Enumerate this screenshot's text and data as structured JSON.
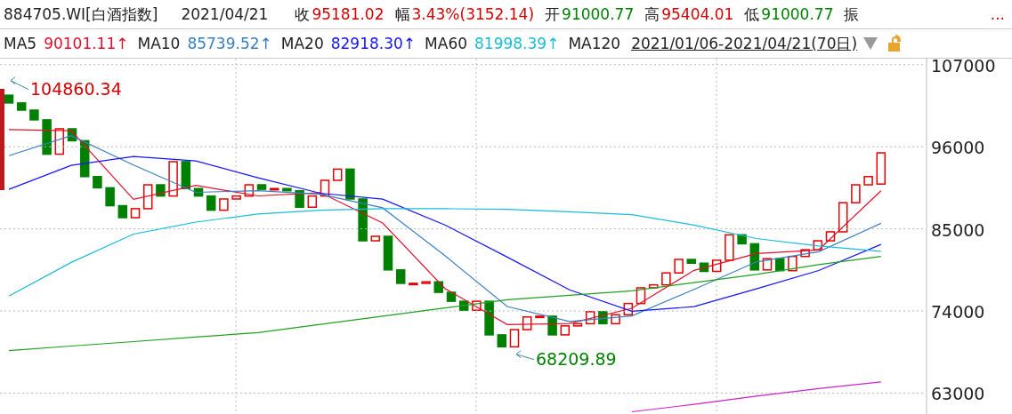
{
  "quote": {
    "code": "884705.WI[白酒指数]",
    "date": "2021/04/21",
    "fields": [
      {
        "label": "收",
        "value": "95181.02",
        "color": "#d40000"
      },
      {
        "label": "幅",
        "value": "3.43%(3152.14)",
        "color": "#d40000"
      },
      {
        "label": "开",
        "value": "91000.77",
        "color": "#008000"
      },
      {
        "label": "高",
        "value": "95404.01",
        "color": "#d40000"
      },
      {
        "label": "低",
        "value": "91000.77",
        "color": "#008000"
      },
      {
        "label": "振"
      }
    ],
    "more": "..."
  },
  "ma_readings": [
    "90101.11↑",
    "85739.52↑",
    "82918.30↑",
    "81998.39↑"
  ],
  "range": "2021/01/06-2021/04/21(70日)",
  "chart_data": {
    "type": "line",
    "grid": true,
    "ylim": [
      60200,
      107800
    ],
    "yticks": [
      63000,
      74000,
      85000,
      96000,
      107000
    ],
    "categories": [
      null,
      null,
      null,
      null,
      null,
      null,
      null,
      null,
      null,
      null,
      null,
      null,
      null,
      null,
      null
    ],
    "series": [
      {
        "name": "MA5",
        "color": "#e0102b",
        "values": [
          98300,
          98140,
          88960,
          90820,
          89420,
          89860,
          85780,
          77020,
          72180,
          72320,
          74360,
          79440,
          81700,
          82180,
          90100
        ]
      },
      {
        "name": "MA10",
        "color": "#3a7fc0",
        "values": [
          94800,
          97500,
          93550,
          89890,
          90120,
          89640,
          87820,
          81400,
          74600,
          72600,
          73340,
          76900,
          80570,
          81940,
          85740
        ]
      },
      {
        "name": "MA20",
        "color": "#1414ff",
        "values": [
          90300,
          93500,
          94700,
          94100,
          91840,
          89770,
          88970,
          85520,
          81210,
          76830,
          73970,
          74580,
          76960,
          79420,
          82920
        ]
      },
      {
        "name": "MA60",
        "color": "#18bcd8",
        "values": [
          76000,
          80500,
          84300,
          85900,
          87000,
          87500,
          87700,
          87700,
          87600,
          87300,
          86900,
          85500,
          83700,
          82700,
          82000
        ]
      },
      {
        "name": "MA120",
        "color": "#20a020",
        "values": [
          68700,
          69300,
          69900,
          70500,
          71100,
          72200,
          73300,
          74400,
          75500,
          76100,
          76700,
          77800,
          78900,
          80200,
          81300
        ]
      },
      {
        "color": "#cc22cc",
        "values": [
          null,
          null,
          null,
          null,
          null,
          null,
          null,
          null,
          null,
          null,
          60500,
          61500,
          62600,
          63600,
          64500
        ]
      }
    ],
    "annotations": [
      "104860.34",
      "68209.89"
    ]
  }
}
